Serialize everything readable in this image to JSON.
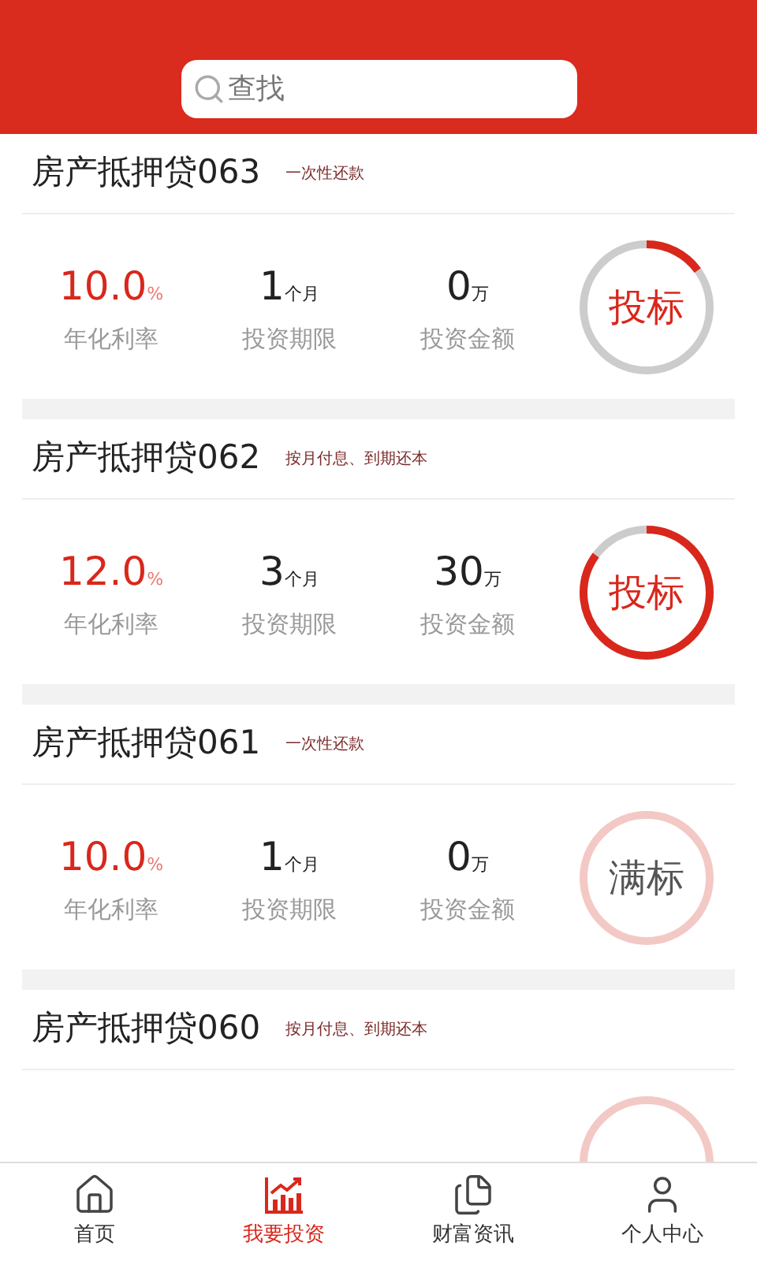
{
  "search": {
    "placeholder": "查找"
  },
  "loans": [
    {
      "title": "房产抵押贷063",
      "repayment": "一次性还款",
      "kind": "bid",
      "level": 0.15,
      "action": "投标",
      "stats": [
        {
          "value": "10.0",
          "unit": "%",
          "label": "年化利率",
          "highlight": true
        },
        {
          "value": "1",
          "unit": "个月",
          "label": "投资期限",
          "highlight": false
        },
        {
          "value": "0",
          "unit": "万",
          "label": "投资金额",
          "highlight": false
        }
      ]
    },
    {
      "title": "房产抵押贷062",
      "repayment": "按月付息、到期还本",
      "kind": "bid",
      "level": 0.85,
      "action": "投标",
      "stats": [
        {
          "value": "12.0",
          "unit": "%",
          "label": "年化利率",
          "highlight": true
        },
        {
          "value": "3",
          "unit": "个月",
          "label": "投资期限",
          "highlight": false
        },
        {
          "value": "30",
          "unit": "万",
          "label": "投资金额",
          "highlight": false
        }
      ]
    },
    {
      "title": "房产抵押贷061",
      "repayment": "一次性还款",
      "kind": "full",
      "action": "满标",
      "stats": [
        {
          "value": "10.0",
          "unit": "%",
          "label": "年化利率",
          "highlight": true
        },
        {
          "value": "1",
          "unit": "个月",
          "label": "投资期限",
          "highlight": false
        },
        {
          "value": "0",
          "unit": "万",
          "label": "投资金额",
          "highlight": false
        }
      ]
    },
    {
      "title": "房产抵押贷060",
      "repayment": "按月付息、到期还本",
      "kind": "full"
    }
  ],
  "tabs": [
    {
      "label": "首页",
      "kind": "home",
      "selected": false
    },
    {
      "label": "我要投资",
      "kind": "invest",
      "selected": true
    },
    {
      "label": "财富资讯",
      "kind": "news",
      "selected": false
    },
    {
      "label": "个人中心",
      "kind": "user",
      "selected": false
    }
  ]
}
